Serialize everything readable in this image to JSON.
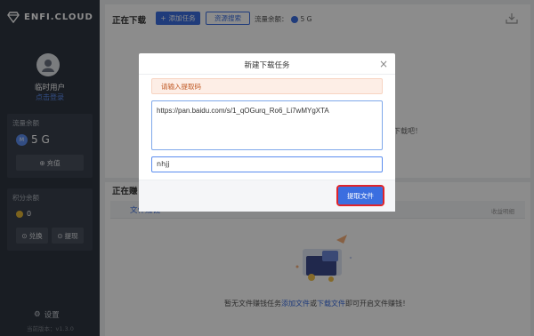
{
  "sidebar": {
    "logo_text": "ENFI.CLOUD",
    "username": "临时用户",
    "login_link": "点击登录",
    "flow_panel": {
      "title": "流量余额",
      "value": "5 G",
      "coin_label": "M",
      "recharge_label": "充值"
    },
    "points_panel": {
      "title": "积分余额",
      "value": "0",
      "exchange_label": "兑换",
      "withdraw_label": "提现"
    },
    "settings_label": "设置",
    "version_text": "当前版本：v1.3.0"
  },
  "downloading": {
    "title": "正在下载",
    "add_task_label": "添加任务",
    "resource_search_label": "资源搜索",
    "quota_label": "流量余额：",
    "quota_value": "5 G",
    "empty_hint": "下载吧！"
  },
  "earning": {
    "title": "正在赚",
    "tabs": [
      "文件赚钱"
    ],
    "corner_note": "收益明细",
    "empty_prefix": "暂无文件赚钱任务",
    "add_file_link": "添加文件",
    "or_text": "或",
    "download_file_link": "下载文件",
    "empty_suffix": "即可开启文件赚钱！"
  },
  "dialog": {
    "title": "新建下载任务",
    "alert_text": "请输入提取码",
    "url_value": "https://pan.baidu.com/s/1_qOGurq_Ro6_Li7wMYgXTA",
    "code_value": "nhjj",
    "extract_label": "提取文件"
  },
  "colors": {
    "sidebar_bg": "#2f3540",
    "accent": "#3b6ee0",
    "alert_bg": "#fdeee6",
    "highlight_border": "#e0242a"
  }
}
